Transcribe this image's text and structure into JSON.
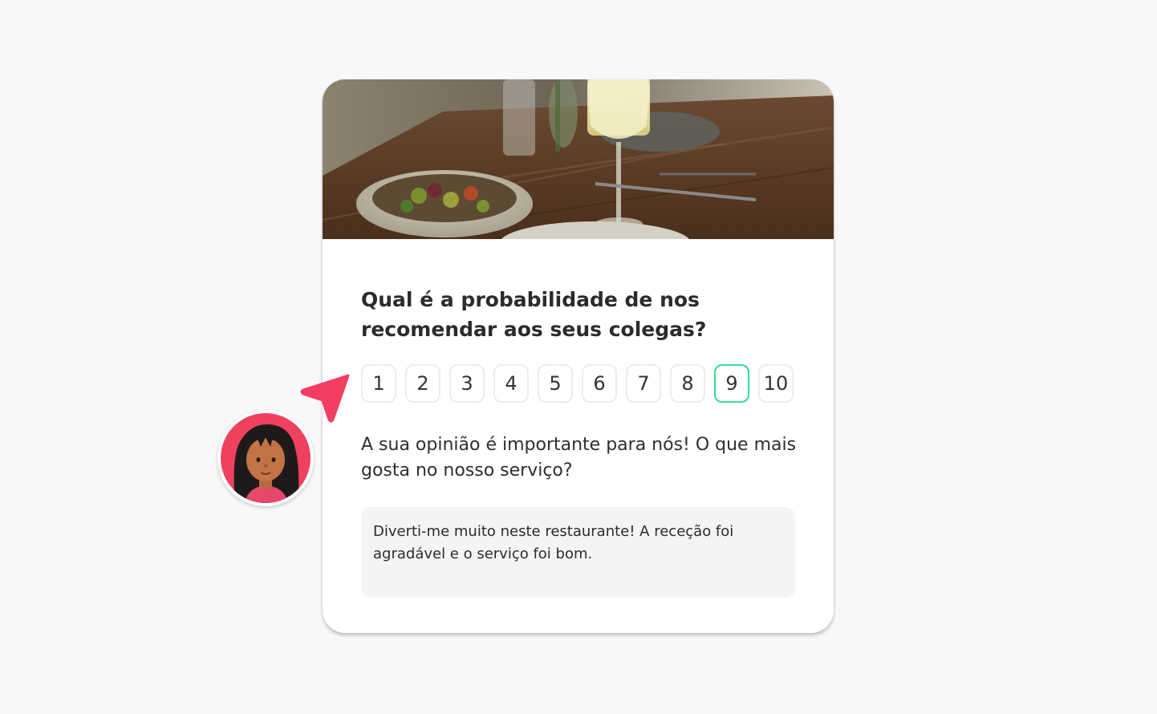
{
  "survey": {
    "question": "Qual é a probabilidade de nos recomendar aos seus colegas?",
    "scale": [
      "1",
      "2",
      "3",
      "4",
      "5",
      "6",
      "7",
      "8",
      "9",
      "10"
    ],
    "selected_value": "9",
    "prompt": "A sua opinião é importante para nós! O que mais gosta no nosso serviço?",
    "answer": "Diverti-me muito neste restaurante! A receção foi agradável e o serviço foi bom."
  },
  "colors": {
    "selected_border": "#2ee091",
    "cursor": "#f33d63",
    "avatar_background": "#f0405f"
  },
  "icons": {
    "cursor": "cursor-arrow-icon",
    "avatar": "user-avatar-icon",
    "hero": "restaurant-table-photo"
  }
}
